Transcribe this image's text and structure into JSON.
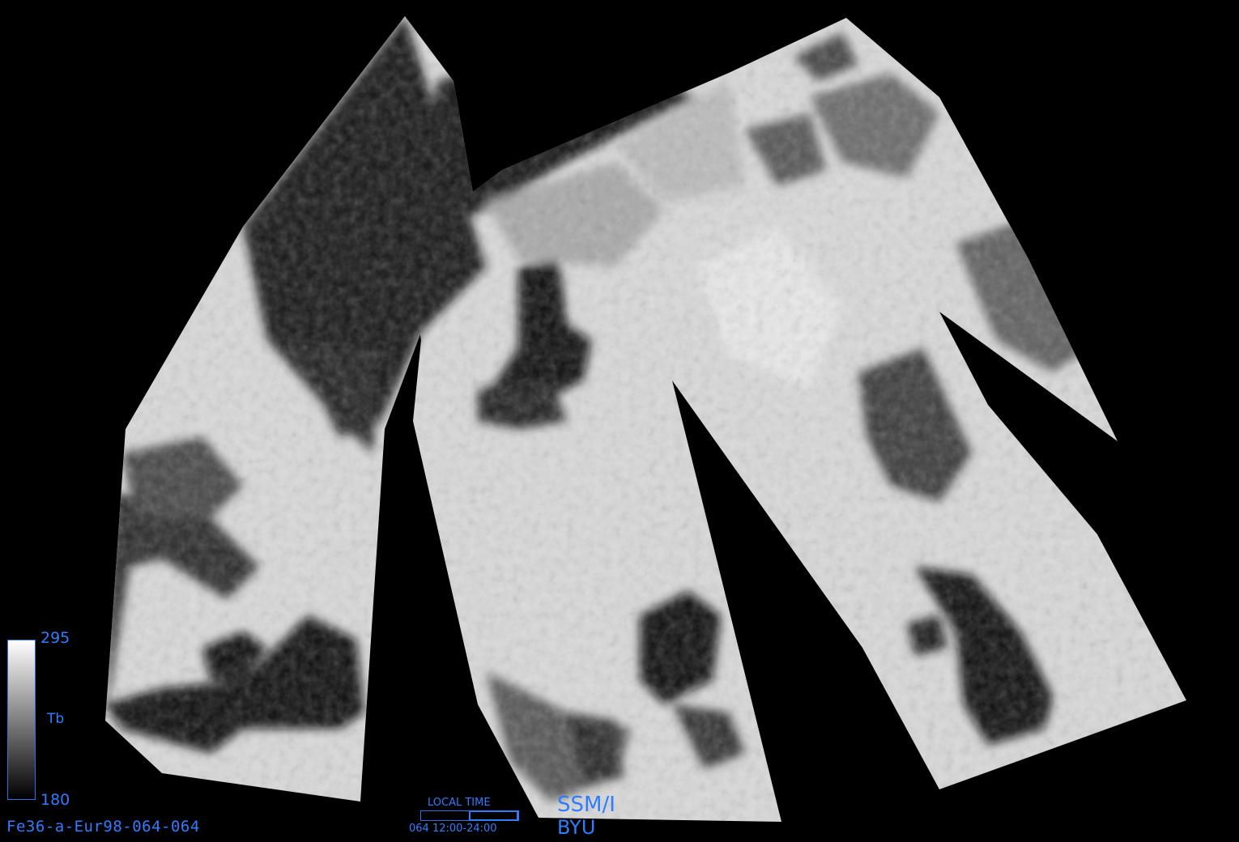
{
  "map": {
    "image_id": "Fe36-a-Eur98-064-064",
    "sensor": "SSM/I",
    "org": "BYU",
    "colorbar": {
      "max": "295",
      "min": "180",
      "variable": "Tb",
      "gradient": [
        "#ffffff",
        "#000000"
      ]
    },
    "local_time": {
      "title": "LOCAL TIME",
      "caption": "064  12:00-24:00",
      "active_fraction": 0.5
    },
    "colors": {
      "background": "#000000",
      "annotation": "#2f7dff"
    }
  }
}
